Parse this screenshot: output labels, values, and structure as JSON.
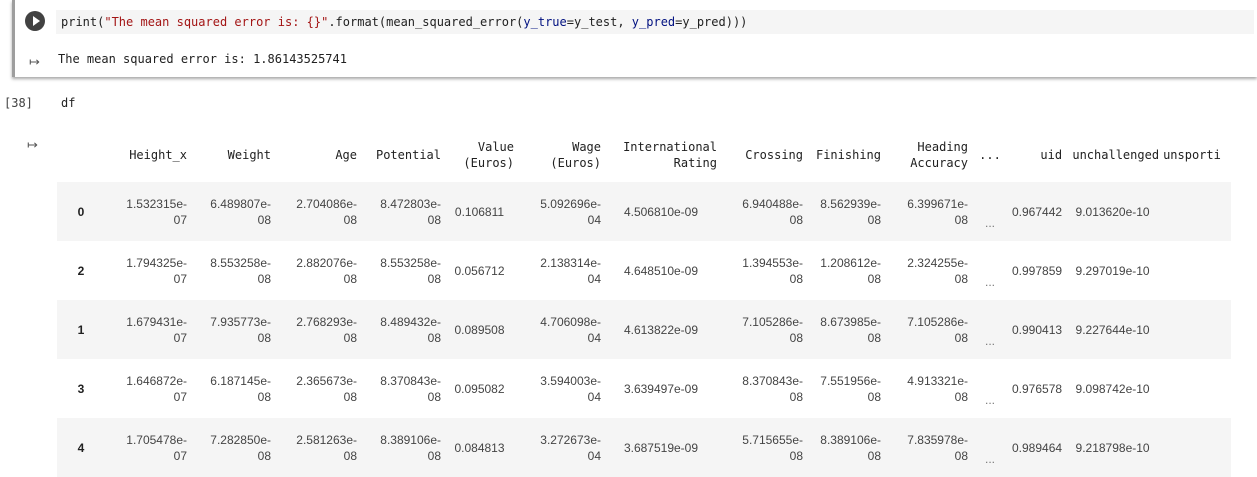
{
  "cell1": {
    "code": {
      "p1": "print(",
      "p2": "\"The mean squared error is: {}\"",
      "p3": ".format(",
      "p4": "mean_squared_error",
      "p5": "(",
      "p6": "y_true",
      "p7": "=y_test, ",
      "p8": "y_pred",
      "p9": "=y_pred)))"
    },
    "output": "The mean squared error is: 1.86143525741"
  },
  "cell2": {
    "execution_count": "[38]",
    "code": "df"
  },
  "icons": {
    "run": "play-circle-icon",
    "output": "output-arrow-icon"
  },
  "dataframe": {
    "columns": [
      "",
      "Height_x",
      "Weight",
      "Age",
      "Potential",
      "Value\n(Euros)",
      "Wage\n(Euros)",
      "International\nRating",
      "Crossing",
      "Finishing",
      "Heading\nAccuracy",
      "...",
      "uid",
      "unchallenged",
      "unsporti"
    ],
    "rows": [
      [
        "0",
        "1.532315e-\n07",
        "6.489807e-\n08",
        "2.704086e-\n08",
        "8.472803e-\n08",
        "0.106811",
        "5.092696e-\n04",
        "4.506810e-09",
        "6.940488e-\n08",
        "8.562939e-\n08",
        "6.399671e-\n08",
        "...",
        "0.967442",
        "9.013620e-10",
        ""
      ],
      [
        "2",
        "1.794325e-\n07",
        "8.553258e-\n08",
        "2.882076e-\n08",
        "8.553258e-\n08",
        "0.056712",
        "2.138314e-\n04",
        "4.648510e-09",
        "1.394553e-\n08",
        "1.208612e-\n08",
        "2.324255e-\n08",
        "...",
        "0.997859",
        "9.297019e-10",
        ""
      ],
      [
        "1",
        "1.679431e-\n07",
        "7.935773e-\n08",
        "2.768293e-\n08",
        "8.489432e-\n08",
        "0.089508",
        "4.706098e-\n04",
        "4.613822e-09",
        "7.105286e-\n08",
        "8.673985e-\n08",
        "7.105286e-\n08",
        "...",
        "0.990413",
        "9.227644e-10",
        ""
      ],
      [
        "3",
        "1.646872e-\n07",
        "6.187145e-\n08",
        "2.365673e-\n08",
        "8.370843e-\n08",
        "0.095082",
        "3.594003e-\n04",
        "3.639497e-09",
        "8.370843e-\n08",
        "7.551956e-\n08",
        "4.913321e-\n08",
        "...",
        "0.976578",
        "9.098742e-10",
        ""
      ],
      [
        "4",
        "1.705478e-\n07",
        "7.282850e-\n08",
        "2.581263e-\n08",
        "8.389106e-\n08",
        "0.084813",
        "3.272673e-\n04",
        "3.687519e-09",
        "5.715655e-\n08",
        "8.389106e-\n08",
        "7.835978e-\n08",
        "...",
        "0.989464",
        "9.218798e-10",
        ""
      ]
    ]
  }
}
